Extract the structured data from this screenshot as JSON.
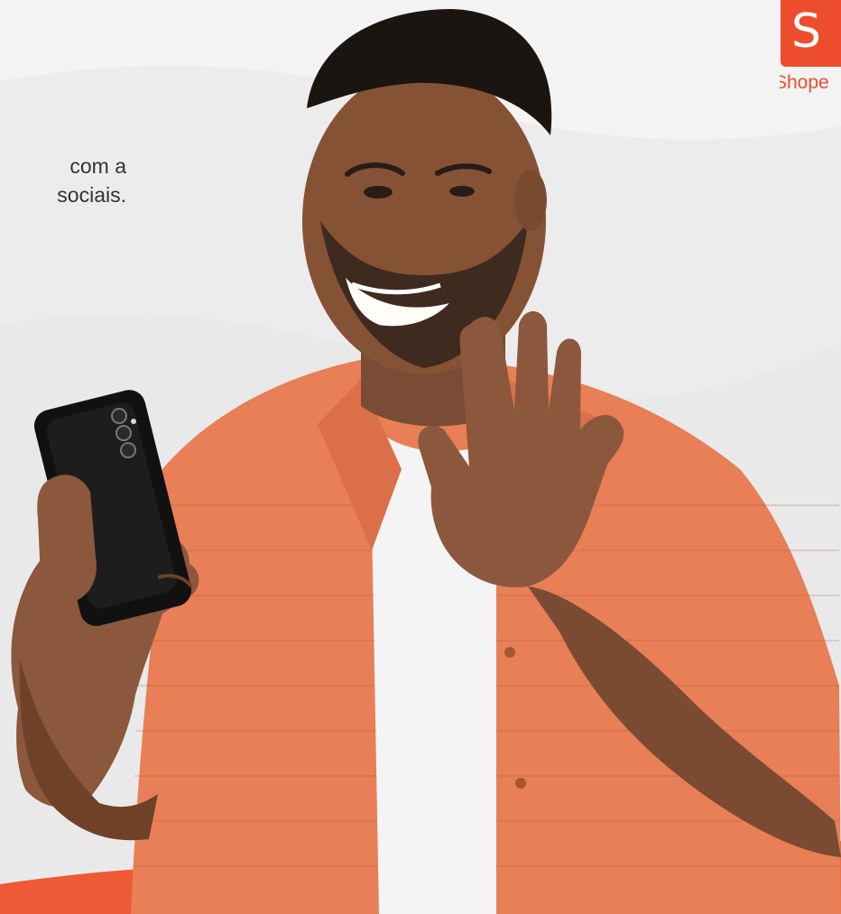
{
  "hero": {
    "text_lines": [
      "com a",
      "sociais."
    ]
  },
  "brand": {
    "logo_letter": "S",
    "logo_text": "Shope",
    "accent_color": "#ee4d2d",
    "background_color": "#ececec"
  },
  "photo": {
    "subject": "smiling man in orange shirt waving while holding a black smartphone"
  }
}
